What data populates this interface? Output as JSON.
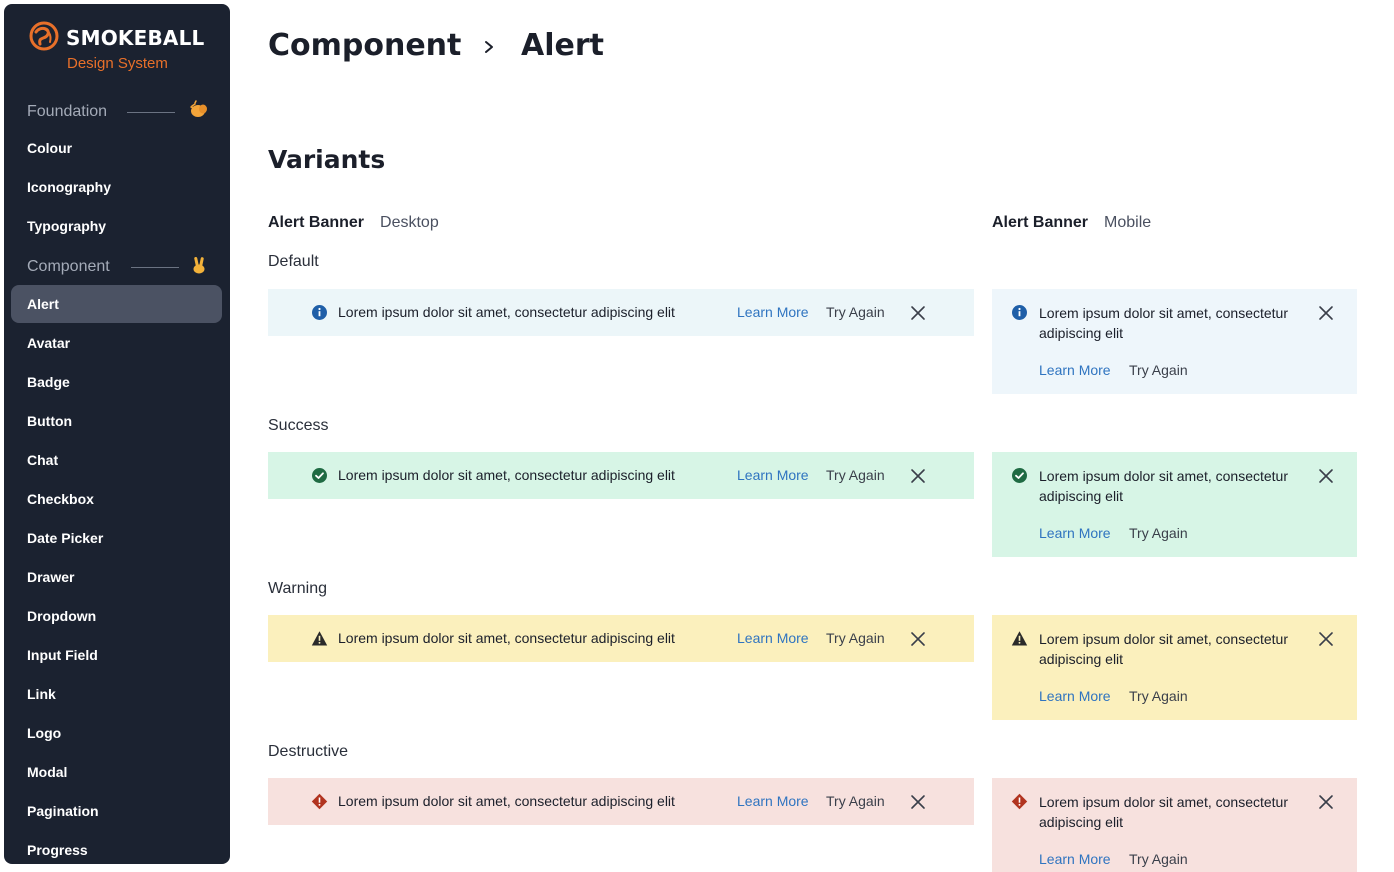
{
  "brand": {
    "name": "SMOKEBALL",
    "subtitle": "Design System",
    "accent_color": "#e8702a"
  },
  "sidebar": {
    "sections": [
      {
        "label": "Foundation",
        "emoji": "fist-bump-icon"
      },
      {
        "label": "Component",
        "emoji": "victory-hand-icon"
      }
    ],
    "foundation_items": [
      {
        "label": "Colour"
      },
      {
        "label": "Iconography"
      },
      {
        "label": "Typography"
      }
    ],
    "component_items": [
      {
        "label": "Alert",
        "active": true
      },
      {
        "label": "Avatar"
      },
      {
        "label": "Badge"
      },
      {
        "label": "Button"
      },
      {
        "label": "Chat"
      },
      {
        "label": "Checkbox"
      },
      {
        "label": "Date Picker"
      },
      {
        "label": "Drawer"
      },
      {
        "label": "Dropdown"
      },
      {
        "label": "Input Field"
      },
      {
        "label": "Link"
      },
      {
        "label": "Logo"
      },
      {
        "label": "Modal"
      },
      {
        "label": "Pagination"
      },
      {
        "label": "Progress"
      }
    ]
  },
  "header": {
    "breadcrumb": [
      "Component",
      "Alert"
    ]
  },
  "main": {
    "section_title": "Variants",
    "desktop_column": {
      "title": "Alert Banner",
      "subtitle": "Desktop"
    },
    "mobile_column": {
      "title": "Alert Banner",
      "subtitle": "Mobile"
    },
    "message": "Lorem ipsum dolor sit amet, consectetur adipiscing elit",
    "learn_more": "Learn More",
    "try_again": "Try Again",
    "variants": [
      {
        "label": "Default",
        "icon": "info-icon",
        "bg": "#ecf6f9",
        "mobile_bg": "#eef6fb",
        "icon_color": "#1f5fa8"
      },
      {
        "label": "Success",
        "icon": "check-circle-icon",
        "bg": "#d7f5e6",
        "mobile_bg": "#d7f5e6",
        "icon_color": "#1f6b43"
      },
      {
        "label": "Warning",
        "icon": "warning-triangle-icon",
        "bg": "#fbf0bd",
        "mobile_bg": "#fbf0bd",
        "icon_color": "#2a2a2a"
      },
      {
        "label": "Destructive",
        "icon": "error-diamond-icon",
        "bg": "#f7e1de",
        "mobile_bg": "#f7e1de",
        "icon_color": "#b1331f"
      }
    ]
  }
}
